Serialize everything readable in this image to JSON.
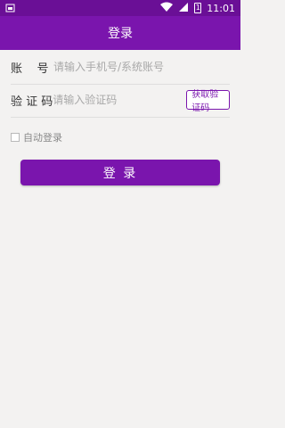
{
  "status_bar": {
    "time": "11:01",
    "battery_level": "1",
    "left_icon": "notification-icon",
    "wifi_icon": "wifi-icon",
    "signal_icon": "signal-icon",
    "battery_icon": "battery-icon"
  },
  "header": {
    "title": "登录"
  },
  "form": {
    "account_label": "账    号",
    "account_placeholder": "请输入手机号/系统账号",
    "code_label": "验 证 码",
    "code_placeholder": "请输入验证码",
    "get_code_label": "获取验证码",
    "auto_login_label": "自动登录",
    "auto_login_checked": false,
    "login_label": "登 录"
  },
  "colors": {
    "primary": "#7a15ad",
    "status_bar": "#6a0f96",
    "background": "#f3f2f1"
  }
}
